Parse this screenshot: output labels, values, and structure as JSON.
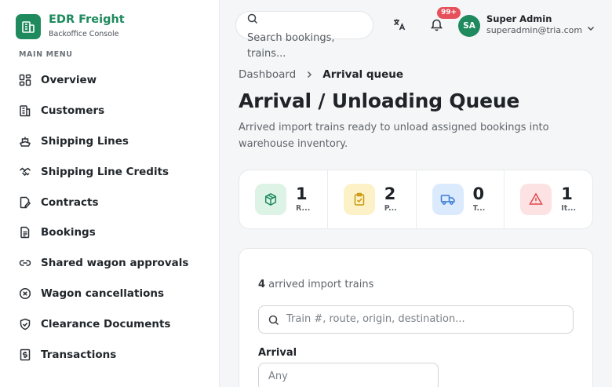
{
  "brand": {
    "name": "EDR Freight",
    "subtitle": "Backoffice Console"
  },
  "sidebar": {
    "caption": "MAIN MENU",
    "items": [
      {
        "label": "Overview",
        "icon": "grid-icon"
      },
      {
        "label": "Customers",
        "icon": "building-icon"
      },
      {
        "label": "Shipping Lines",
        "icon": "ship-icon"
      },
      {
        "label": "Shipping Line Credits",
        "icon": "handshake-icon"
      },
      {
        "label": "Contracts",
        "icon": "contract-icon"
      },
      {
        "label": "Bookings",
        "icon": "document-icon"
      },
      {
        "label": "Shared wagon approvals",
        "icon": "link-icon"
      },
      {
        "label": "Wagon cancellations",
        "icon": "cancel-circle-icon"
      },
      {
        "label": "Clearance Documents",
        "icon": "shield-check-icon"
      },
      {
        "label": "Transactions",
        "icon": "dollar-receipt-icon"
      }
    ]
  },
  "header": {
    "search_placeholder": "Search bookings, trains...",
    "notifications_badge": "99+",
    "user": {
      "initials": "SA",
      "name": "Super Admin",
      "email": "superadmin@tria.com"
    }
  },
  "breadcrumb": {
    "parent": "Dashboard",
    "current": "Arrival queue"
  },
  "page": {
    "title": "Arrival / Unloading Queue",
    "description": "Arrived import trains ready to unload assigned bookings into warehouse inventory."
  },
  "stats": [
    {
      "value": "1",
      "label": "R...",
      "icon": "box-icon",
      "bg": "#dcf3e6",
      "fg": "#1e8a5e"
    },
    {
      "value": "2",
      "label": "P...",
      "icon": "clipboard-check-icon",
      "bg": "#fdf1c7",
      "fg": "#c99a0e"
    },
    {
      "value": "0",
      "label": "T...",
      "icon": "truck-icon",
      "bg": "#dbeafc",
      "fg": "#3a7bd5"
    },
    {
      "value": "1",
      "label": "It...",
      "icon": "warning-icon",
      "bg": "#fde2e3",
      "fg": "#e04850"
    }
  ],
  "queue": {
    "count": "4",
    "count_suffix": " arrived import trains",
    "filter_placeholder": "Train #, route, origin, destination...",
    "arrival_label": "Arrival",
    "arrival_value": "Any"
  }
}
